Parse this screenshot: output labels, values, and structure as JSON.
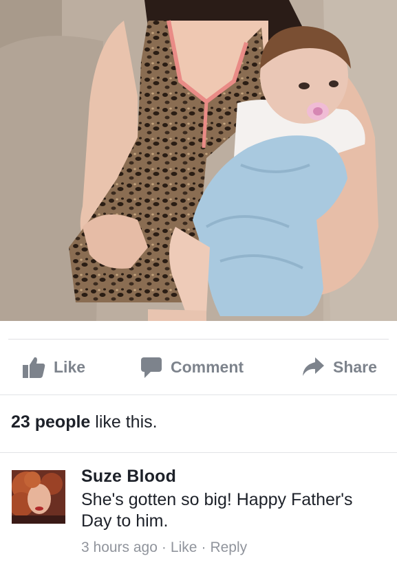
{
  "actions": {
    "like_label": "Like",
    "comment_label": "Comment",
    "share_label": "Share"
  },
  "likes": {
    "count_text": "23 people",
    "suffix_text": " like this."
  },
  "comment": {
    "author": "Suze Blood",
    "text": "She's gotten so big! Happy Father's Day to him.",
    "timestamp": "3 hours ago",
    "separator_1": "·",
    "like_label": "Like",
    "separator_2": "·",
    "reply_label": "Reply"
  },
  "colors": {
    "action_gray": "#7d838c",
    "text_dark": "#1d2129",
    "meta_gray": "#90949c",
    "divider": "#dfe0e4"
  },
  "icons": {
    "like": "thumbs-up-icon",
    "comment": "speech-bubble-icon",
    "share": "share-arrow-icon"
  }
}
